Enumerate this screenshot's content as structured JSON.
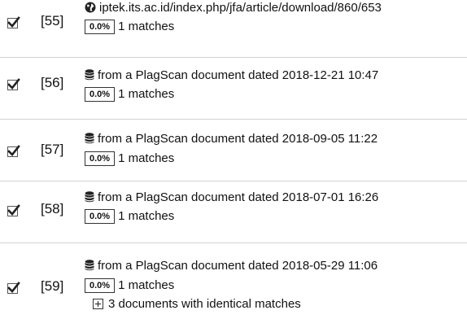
{
  "sources": [
    {
      "number": "[55]",
      "checked": true,
      "source_icon": "globe-icon",
      "source_text": "iptek.its.ac.id/index.php/jfa/article/download/860/653",
      "percent": "0.0%",
      "matches": "1 matches"
    },
    {
      "number": "[56]",
      "checked": true,
      "source_icon": "database-icon",
      "source_text": "from a PlagScan document dated 2018-12-21 10:47",
      "percent": "0.0%",
      "matches": "1 matches"
    },
    {
      "number": "[57]",
      "checked": true,
      "source_icon": "database-icon",
      "source_text": "from a PlagScan document dated 2018-09-05 11:22",
      "percent": "0.0%",
      "matches": "1 matches"
    },
    {
      "number": "[58]",
      "checked": true,
      "source_icon": "database-icon",
      "source_text": "from a PlagScan document dated 2018-07-01 16:26",
      "percent": "0.0%",
      "matches": "1 matches"
    },
    {
      "number": "[59]",
      "checked": true,
      "source_icon": "database-icon",
      "source_text": "from a PlagScan document dated 2018-05-29 11:06",
      "percent": "0.0%",
      "matches": "1 matches",
      "identical": "3 documents with identical matches",
      "identical_icon": "expand-plus-icon"
    }
  ],
  "colors": {
    "divider": "#d2d2d2",
    "text": "#111111",
    "checkmark": "#222222"
  }
}
